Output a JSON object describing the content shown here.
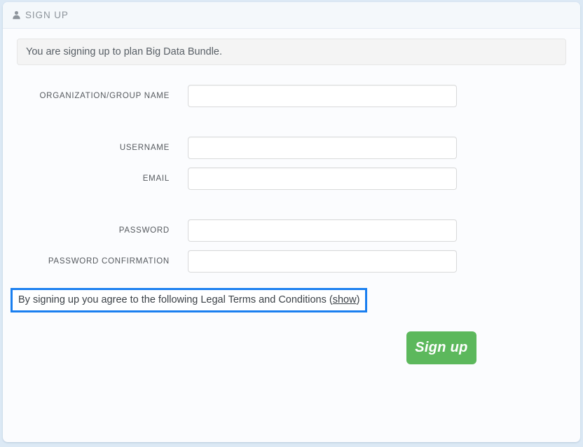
{
  "page": {
    "background_color": "#dce9f5",
    "panel_background": "#fbfcfe"
  },
  "header": {
    "icon": "user-icon",
    "title": "SIGN UP"
  },
  "alert": {
    "message": "You are signing up to plan Big Data Bundle."
  },
  "form": {
    "fields": [
      {
        "label": "ORGANIZATION/GROUP NAME",
        "value": "",
        "placeholder": "",
        "type": "text",
        "name": "organization-group-name"
      },
      {
        "label": "USERNAME",
        "value": "",
        "placeholder": "",
        "type": "text",
        "name": "username"
      },
      {
        "label": "EMAIL",
        "value": "",
        "placeholder": "",
        "type": "text",
        "name": "email"
      },
      {
        "label": "PASSWORD",
        "value": "",
        "placeholder": "",
        "type": "password",
        "name": "password"
      },
      {
        "label": "PASSWORD CONFIRMATION",
        "value": "",
        "placeholder": "",
        "type": "password",
        "name": "password-confirmation"
      }
    ]
  },
  "legal": {
    "text_before": "By signing up you agree to the following Legal Terms and Conditions (",
    "link_label": "show",
    "text_after": ")",
    "highlight_color": "#1a7ff0"
  },
  "submit": {
    "label": "Sign up",
    "color": "#5cb85c"
  }
}
